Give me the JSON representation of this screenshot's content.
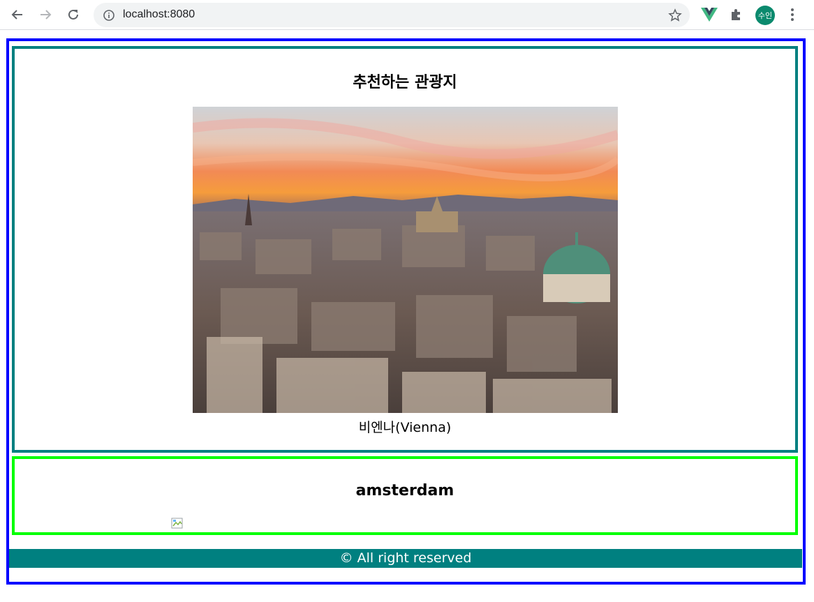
{
  "browser": {
    "url": "localhost:8080",
    "profile_initials": "수인",
    "icons": {
      "back": "arrow-left-icon",
      "forward": "arrow-right-icon",
      "reload": "reload-icon",
      "info": "info-icon",
      "bookmark": "star-icon",
      "vue_devtools": "vue-icon",
      "extensions": "puzzle-icon",
      "menu": "kebab-menu-icon"
    }
  },
  "recommend": {
    "title": "추천하는 관광지",
    "caption": "비엔나(Vienna)"
  },
  "second": {
    "title": "amsterdam"
  },
  "footer": {
    "text": "© All right reserved"
  },
  "colors": {
    "outer_border": "#0000ff",
    "teal_border": "#008080",
    "green_border": "#00ff00",
    "footer_bg": "#008080"
  }
}
